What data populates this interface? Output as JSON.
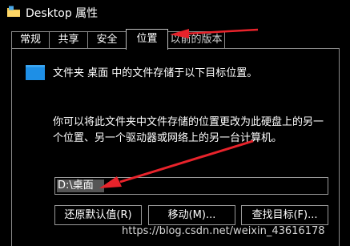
{
  "window": {
    "title": "Desktop 属性"
  },
  "tabs": [
    {
      "label": "常规"
    },
    {
      "label": "共享"
    },
    {
      "label": "安全"
    },
    {
      "label": "位置",
      "active": true
    },
    {
      "label": "以前的版本"
    }
  ],
  "location": {
    "header": "文件夹 桌面 中的文件存储于以下目标位置。",
    "description": "你可以将此文件夹中文件存储的位置更改为此硬盘上的另一个位置、另一个驱动器或网络上的另一台计算机。",
    "path_value": "D:\\桌面",
    "buttons": {
      "restore": "还原默认值(R)",
      "move": "移动(M)...",
      "find_target": "查找目标(F)..."
    }
  },
  "annotations": {
    "arrow_color": "#e8232b"
  },
  "watermark": "https://blog.csdn.net/weixin_43616178",
  "colors": {
    "background": "#000000",
    "text": "#ffffff",
    "folder_icon": "#1e8fe6"
  }
}
